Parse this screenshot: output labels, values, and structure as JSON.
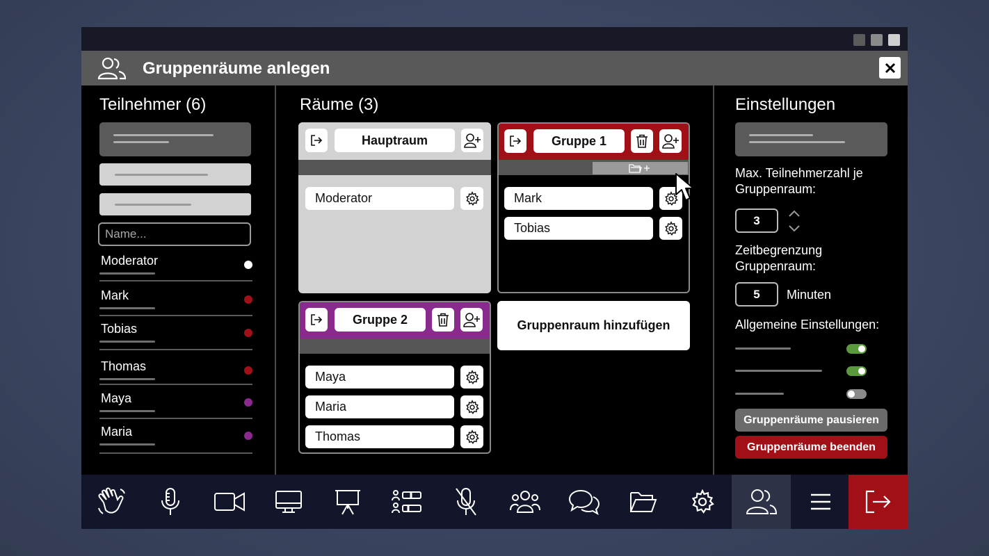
{
  "dialog": {
    "title": "Gruppenräume anlegen",
    "close_icon": "close-icon",
    "title_icon": "participants-icon"
  },
  "participants": {
    "heading": "Teilnehmer (6)",
    "search_placeholder": "Name...",
    "items": [
      {
        "name": "Moderator",
        "status_color": "#ffffff"
      },
      {
        "name": "Mark",
        "status_color": "#a01016"
      },
      {
        "name": "Tobias",
        "status_color": "#a01016"
      },
      {
        "name": "Thomas",
        "status_color": "#a01016"
      },
      {
        "name": "Maya",
        "status_color": "#8b2a8e"
      },
      {
        "name": "Maria",
        "status_color": "#8b2a8e"
      }
    ]
  },
  "rooms": {
    "heading": "Räume (3)",
    "list": [
      {
        "name": "Hauptraum",
        "color": "#d2d2d2",
        "members": [
          "Moderator"
        ]
      },
      {
        "name": "Gruppe 1",
        "color": "#a01016",
        "members": [
          "Mark",
          "Tobias"
        ]
      },
      {
        "name": "Gruppe 2",
        "color": "#8b2a8e",
        "members": [
          "Maya",
          "Maria",
          "Thomas"
        ]
      }
    ],
    "add_room_label": "Gruppenraum hinzufügen"
  },
  "settings": {
    "heading": "Einstellungen",
    "max_participants_label": "Max. Teilnehmerzahl je Gruppenraum:",
    "max_participants_value": "3",
    "time_limit_label": "Zeitbegrenzung Gruppenraum:",
    "time_limit_value": "5",
    "time_limit_unit": "Minuten",
    "general_label": "Allgemeine Einstellungen:",
    "toggles": [
      true,
      true,
      false
    ],
    "pause_button": "Gruppenräume pausieren",
    "end_button": "Gruppenräume beenden",
    "colors": {
      "on": "#5b9a3c",
      "off": "#8a8a8a",
      "pause": "#6b6b6b",
      "end": "#a01016"
    }
  },
  "taskbar": {
    "items": [
      "raise-hand-icon",
      "microphone-icon",
      "camera-icon",
      "screen-share-icon",
      "presentation-icon",
      "polls-icon",
      "mute-all-icon",
      "participants-icon",
      "chat-icon",
      "files-icon",
      "settings-icon",
      "breakout-rooms-icon",
      "menu-icon",
      "leave-icon"
    ],
    "active": "breakout-rooms-icon",
    "leave_color": "#a01016"
  }
}
